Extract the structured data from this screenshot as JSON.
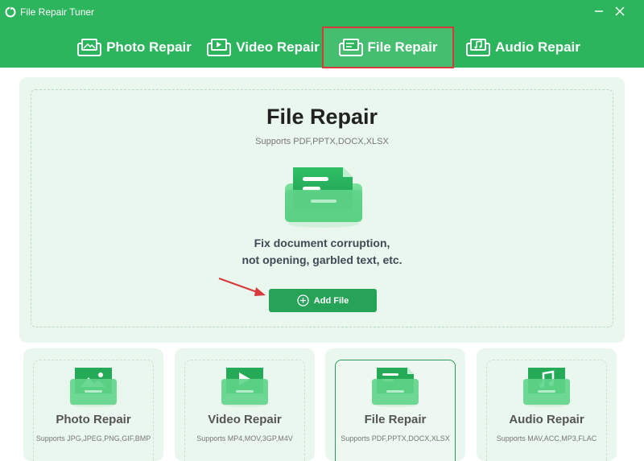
{
  "app": {
    "title": "File Repair Tuner",
    "icon": "refresh-logo-icon"
  },
  "window": {
    "minimize_icon": "minimize-icon",
    "close_icon": "close-icon"
  },
  "tabs": [
    {
      "label": "Photo Repair",
      "icon": "photo-icon",
      "active": false
    },
    {
      "label": "Video Repair",
      "icon": "video-icon",
      "active": false
    },
    {
      "label": "File Repair",
      "icon": "file-icon",
      "active": true
    },
    {
      "label": "Audio Repair",
      "icon": "audio-icon",
      "active": false
    }
  ],
  "main": {
    "title": "File Repair",
    "subtitle": "Supports PDF,PPTX,DOCX,XLSX",
    "desc_line1": "Fix document corruption,",
    "desc_line2": "not opening, garbled text, etc.",
    "add_button": "Add File"
  },
  "cards": [
    {
      "title": "Photo Repair",
      "sub": "Supports JPG,JPEG,PNG,GIF,BMP"
    },
    {
      "title": "Video Repair",
      "sub": "Supports MP4,MOV,3GP,M4V"
    },
    {
      "title": "File Repair",
      "sub": "Supports PDF,PPTX,DOCX,XLSX"
    },
    {
      "title": "Audio Repair",
      "sub": "Supports MAV,ACC,MP3,FLAC"
    }
  ],
  "colors": {
    "brand": "#2db55d",
    "button": "#27a357",
    "highlight": "#d8393a"
  }
}
